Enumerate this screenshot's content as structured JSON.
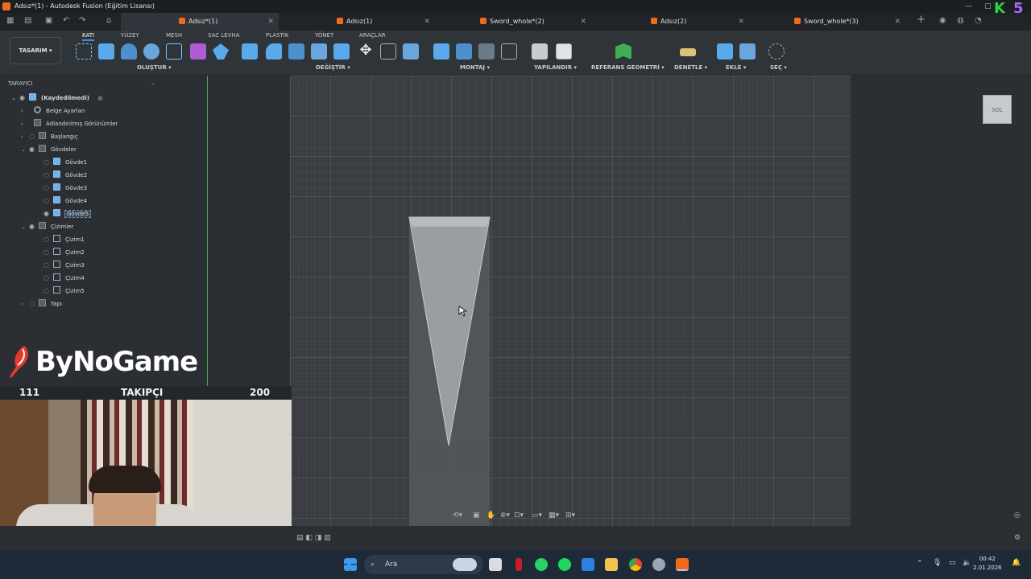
{
  "window": {
    "title": "Adsız*(1) - Autodesk Fusion (Eğitim Lisansı)"
  },
  "tabs": [
    {
      "label": "Adsız*(1)"
    },
    {
      "label": "Adsız(1)"
    },
    {
      "label": "Sword_whole*(2)"
    },
    {
      "label": "Adsız(2)"
    },
    {
      "label": "Sword_whole*(3)"
    }
  ],
  "toolbar": {
    "workspace": "TASARIM ▾",
    "ws_tabs": [
      "KATI",
      "YÜZEY",
      "MESH",
      "SAC LEVHA",
      "PLASTİK",
      "YÖNET",
      "ARAÇLAR"
    ],
    "groups": [
      "OLUŞTUR ▾",
      "DEĞİŞTİR ▾",
      "MONTAJ ▾",
      "YAPILANDIR ▾",
      "REFERANS GEOMETRİ ▾",
      "DENETLE ▾",
      "EKLE ▾",
      "SEÇ ▾"
    ]
  },
  "browser": {
    "title": "TARAYICI",
    "root": "(Kaydedilmedi)",
    "items": [
      "Belge Ayarları",
      "Adlandırılmış Görünümler",
      "Başlangıç",
      "Gövdeler",
      "Gövde1",
      "Gövde2",
      "Gövde3",
      "Gövde4",
      "Gövde5",
      "Çizimler",
      "Çizim1",
      "Çizim2",
      "Çizim3",
      "Çizim4",
      "Çizim5",
      "Yapı"
    ]
  },
  "viewcube": {
    "label": "SOL"
  },
  "overlay": {
    "brand": "ByNoGame",
    "follow_left": "111",
    "follow_label": "TAKIPÇI",
    "follow_right": "200",
    "corner_k": "K",
    "corner_5": "5"
  },
  "taskbar": {
    "search": "Ara",
    "time": "00:42",
    "date": "2.01.2026"
  },
  "colors": {
    "accent": "#3c8fe6",
    "fusion_orange": "#f26b1d",
    "axis_green": "#3fae55"
  }
}
